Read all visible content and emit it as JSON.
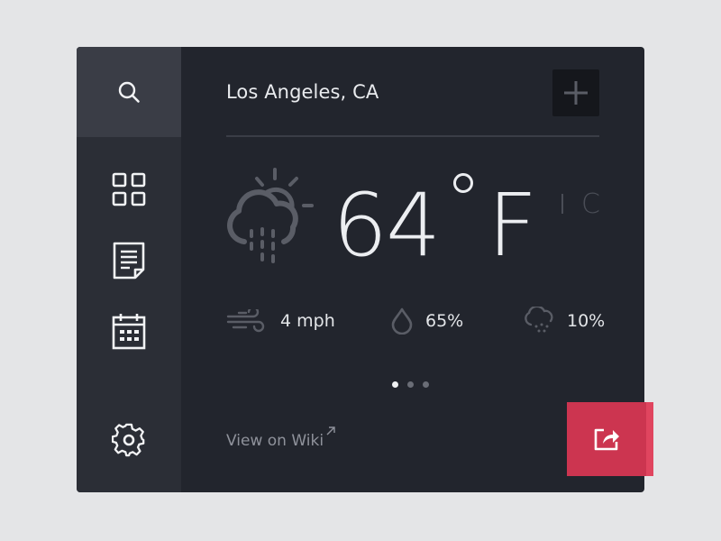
{
  "location": {
    "city": "Los Angeles, CA"
  },
  "current": {
    "temperature": "64",
    "unit_primary": "F",
    "unit_secondary": "C",
    "condition_icon": "partly-cloudy-rain-icon"
  },
  "stats": {
    "wind": {
      "value": "4 mph",
      "icon": "wind-icon"
    },
    "humidity": {
      "value": "65%",
      "icon": "droplet-icon"
    },
    "precipitation": {
      "value": "10%",
      "icon": "rain-cloud-icon"
    }
  },
  "pagination": {
    "pages": 3,
    "active_index": 0
  },
  "footer": {
    "wiki_link": "View on Wiki"
  },
  "sidebar": {
    "items": [
      {
        "name": "search",
        "icon": "search-icon"
      },
      {
        "name": "grid",
        "icon": "grid-icon"
      },
      {
        "name": "document",
        "icon": "document-icon"
      },
      {
        "name": "calendar",
        "icon": "calendar-icon"
      },
      {
        "name": "settings",
        "icon": "gear-icon"
      }
    ]
  },
  "colors": {
    "background": "#e4e5e7",
    "panel": "#22252d",
    "sidebar": "#2b2e36",
    "sidebar_active": "#3a3d46",
    "accent": "#cc3550",
    "text": "#eceef1",
    "muted": "#8f929b"
  }
}
